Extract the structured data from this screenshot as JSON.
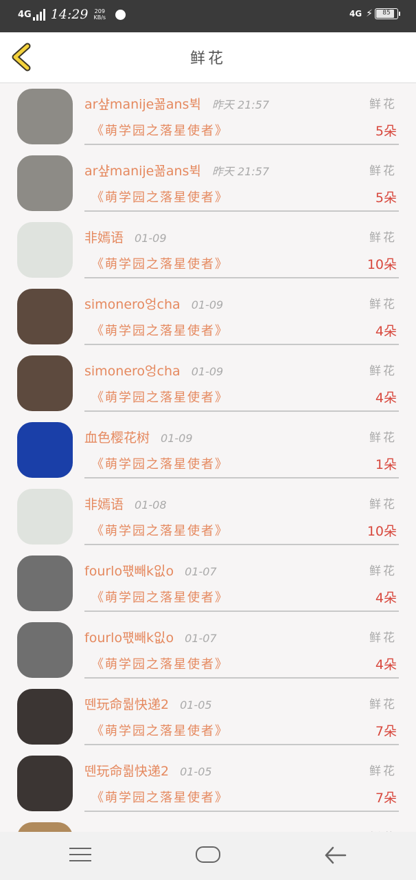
{
  "status_bar": {
    "network_left": "4G",
    "time": "14:29",
    "speed_value": "209",
    "speed_unit": "KB/s",
    "network_right": "4G",
    "battery": "85"
  },
  "header": {
    "title": "鲜花",
    "back_icon": "chevron-left-icon"
  },
  "list": [
    {
      "name": "ar샾manije꾦ans뷕",
      "time": "昨天 21:57",
      "type": "鲜花",
      "book": "《萌学园之落星使者》",
      "count": "5朵",
      "avatar_color": "#8d8b86"
    },
    {
      "name": "ar샾manije꾦ans뷕",
      "time": "昨天 21:57",
      "type": "鲜花",
      "book": "《萌学园之落星使者》",
      "count": "5朵",
      "avatar_color": "#8d8b86"
    },
    {
      "name": "非嫣语",
      "time": "01-09",
      "type": "鲜花",
      "book": "《萌学园之落星使者》",
      "count": "10朵",
      "avatar_color": "#dfe3de"
    },
    {
      "name": "simonero엉cha",
      "time": "01-09",
      "type": "鲜花",
      "book": "《萌学园之落星使者》",
      "count": "4朵",
      "avatar_color": "#5d4a3e"
    },
    {
      "name": "simonero엉cha",
      "time": "01-09",
      "type": "鲜花",
      "book": "《萌学园之落星使者》",
      "count": "4朵",
      "avatar_color": "#5d4a3e"
    },
    {
      "name": "血色樱花树",
      "time": "01-09",
      "type": "鲜花",
      "book": "《萌学园之落星使者》",
      "count": "1朵",
      "avatar_color": "#1a3fa8"
    },
    {
      "name": "非嫣语",
      "time": "01-08",
      "type": "鲜花",
      "book": "《萌学园之落星使者》",
      "count": "10朵",
      "avatar_color": "#dfe3de"
    },
    {
      "name": "fourlo퍣빼k잆o",
      "time": "01-07",
      "type": "鲜花",
      "book": "《萌学园之落星使者》",
      "count": "4朵",
      "avatar_color": "#6f6f6f"
    },
    {
      "name": "fourlo퍣빼k잆o",
      "time": "01-07",
      "type": "鲜花",
      "book": "《萌学园之落星使者》",
      "count": "4朵",
      "avatar_color": "#6f6f6f"
    },
    {
      "name": "뗀玩命뤎快递2",
      "time": "01-05",
      "type": "鲜花",
      "book": "《萌学园之落星使者》",
      "count": "7朵",
      "avatar_color": "#3b3533"
    },
    {
      "name": "뗀玩命뤎快递2",
      "time": "01-05",
      "type": "鲜花",
      "book": "《萌学园之落星使者》",
      "count": "7朵",
      "avatar_color": "#3b3533"
    },
    {
      "name": "",
      "time": "",
      "type": "鲜花",
      "book": "",
      "count": "",
      "avatar_color": "#b08a5c"
    }
  ],
  "nav": {
    "menu_icon": "menu-icon",
    "home_icon": "home-icon",
    "back_icon": "back-arrow-icon"
  }
}
